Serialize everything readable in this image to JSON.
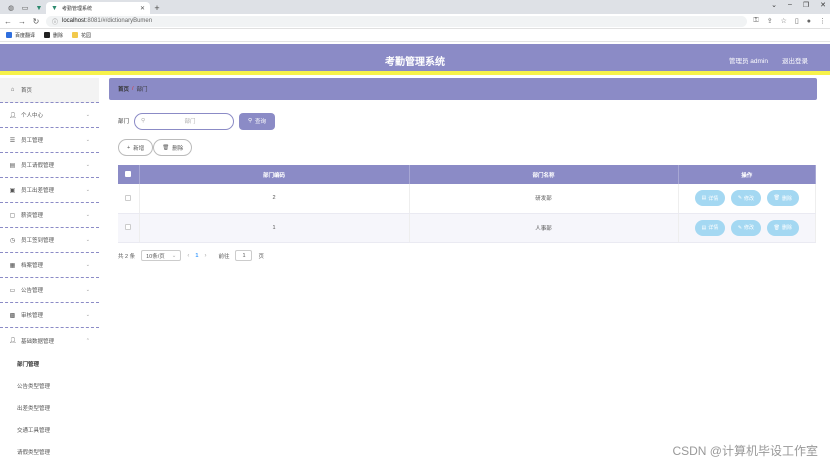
{
  "browser": {
    "tab_title": "考勤管理系统",
    "url_host": "localhost",
    "url_rest": ":8081/#/dictionaryBumen",
    "bookmarks": [
      "百度翻译",
      "删除",
      "花园"
    ]
  },
  "header": {
    "title": "考勤管理系统",
    "user_label": "管理员 admin",
    "logout_label": "退出登录",
    "accent": "#8b8bc6",
    "stripe": "#f7f24a"
  },
  "sidebar": {
    "items": [
      {
        "label": "首页",
        "icon": "home-icon"
      },
      {
        "label": "个人中心",
        "icon": "user-icon"
      },
      {
        "label": "员工管理",
        "icon": "list-icon"
      },
      {
        "label": "员工请假管理",
        "icon": "document-icon"
      },
      {
        "label": "员工出差管理",
        "icon": "suitcase-icon"
      },
      {
        "label": "薪资管理",
        "icon": "chat-icon"
      },
      {
        "label": "员工签到管理",
        "icon": "clock-icon"
      },
      {
        "label": "档案管理",
        "icon": "archive-icon"
      },
      {
        "label": "公告管理",
        "icon": "ticket-icon"
      },
      {
        "label": "审核管理",
        "icon": "stamp-icon"
      },
      {
        "label": "基础数据管理",
        "icon": "user-icon"
      }
    ],
    "subitems": [
      "部门管理",
      "公告类型管理",
      "出差类型管理",
      "交通工具管理",
      "请假类型管理"
    ]
  },
  "main": {
    "breadcrumb_home": "首页",
    "breadcrumb_sep": "/",
    "breadcrumb_current": "部门",
    "search_label": "部门",
    "search_placeholder": "部门",
    "search_button": "查询",
    "add_button": "新增",
    "delete_button": "删除",
    "table": {
      "headers": [
        "部门编码",
        "部门名称",
        "操作"
      ],
      "rows": [
        {
          "code": "2",
          "name": "研发部"
        },
        {
          "code": "1",
          "name": "人事部"
        }
      ],
      "ops": [
        "详情",
        "修改",
        "删除"
      ]
    },
    "pager": {
      "total": "共 2 条",
      "page_size": "10条/页",
      "current_page": "1",
      "goto_label": "前往",
      "goto_value": "1",
      "page_unit": "页"
    }
  },
  "watermark": "CSDN @计算机毕设工作室"
}
